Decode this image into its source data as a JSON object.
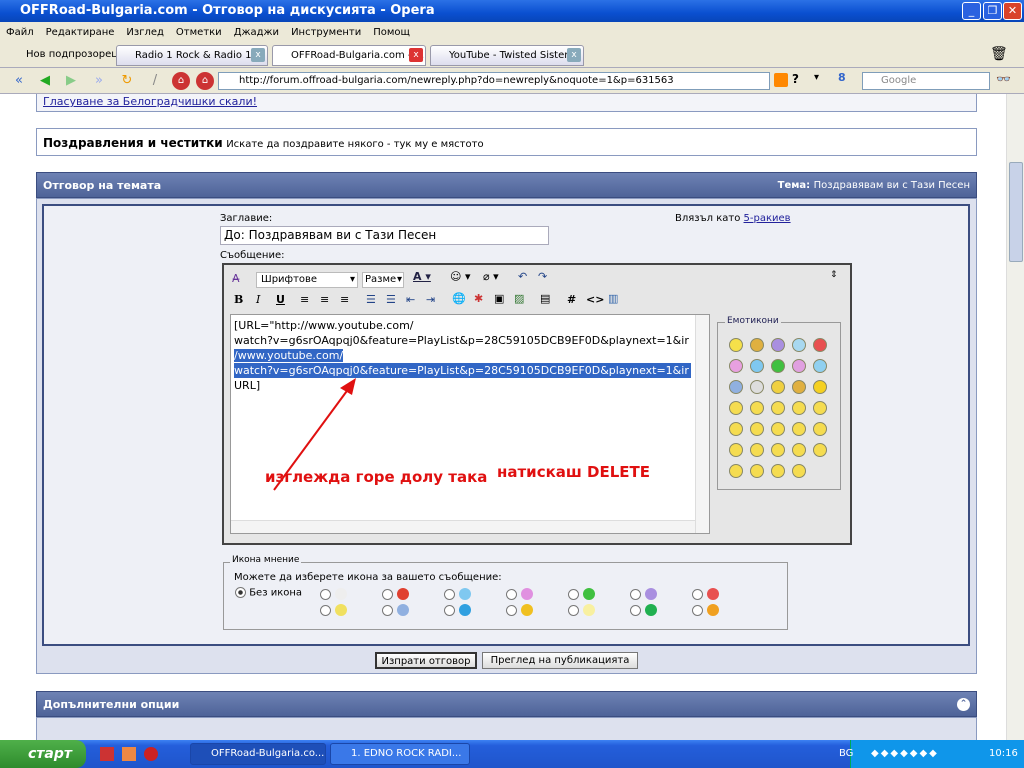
{
  "window": {
    "title": "OFFRoad-Bulgaria.com - Отговор на дискусията - Opera"
  },
  "menu": [
    "Файл",
    "Редактиране",
    "Изглед",
    "Отметки",
    "Джаджи",
    "Инструменти",
    "Помощ"
  ],
  "tabs": {
    "new_tab": "Нов подпрозорец",
    "items": [
      "Radio 1 Rock & Radio 1 ...",
      "OFFRoad-Bulgaria.com - ...",
      "YouTube - Twisted Sister..."
    ]
  },
  "address": {
    "url": "http://forum.offroad-bulgaria.com/newreply.php?do=newreply&noquote=1&p=631563",
    "search_placeholder": "Google"
  },
  "forum": {
    "poll_link": "Гласуване за Белоградчишки скали!",
    "category_title": "Поздравления и честитки",
    "category_desc": "Искате да поздравите някого - тук му е мястото",
    "reply_header": "Отговор на темата",
    "topic_label": "Тема:",
    "topic_value": "Поздравявам ви с Тази Песен",
    "title_label": "Заглавие:",
    "title_value": "До: Поздравявам ви с Тази Песен",
    "logged_as": "Влязъл като",
    "username": "5-ракиев",
    "message_label": "Съобщение:",
    "font_select": "Шрифтове",
    "size_select": "Разме",
    "message_lines": [
      "[URL=\"http://www.youtube.com/",
      "watch?v=g6srOAqpqj0&feature=PlayList&p=28C59105DCB9EF0D&playnext=1&ir",
      "/www.youtube.com/",
      "watch?v=g6srOAqpqj0&feature=PlayList&p=28C59105DCB9EF0D&playnext=1&ir",
      "URL]"
    ],
    "annotation_left": "изглежда горе долу така",
    "annotation_right": "натискаш DELETE",
    "smilies_legend": "Емотикони",
    "icon_legend": "Икона мнение",
    "icon_prompt": "Можете да изберете икона за вашето съобщение:",
    "no_icon": "Без икона",
    "submit": "Изпрати отговор",
    "preview": "Преглед на публикацията",
    "extra_options": "Допълнителни опции"
  },
  "taskbar": {
    "start": "старт",
    "tasks": [
      "OFFRoad-Bulgaria.co...",
      "1. EDNO ROCK RADI..."
    ],
    "lang": "BG",
    "clock": "10:16"
  }
}
